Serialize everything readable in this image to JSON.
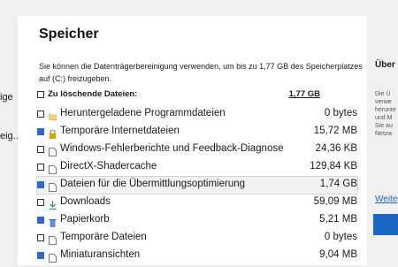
{
  "sidebar": {
    "items": [
      {
        "label": "ige"
      },
      {
        "label": "eig..."
      }
    ]
  },
  "main": {
    "title": "Speicher",
    "description": "Sie können die Datenträgerbereinigung verwenden, um bis zu 1,77 GB des Speicherplatzes auf  (C:) freizugeben.",
    "header": {
      "label": "Zu löschende Dateien:",
      "total": "1,77 GB",
      "checked": false
    },
    "files": [
      {
        "label": "Heruntergeladene Programmdateien",
        "size": "0 bytes",
        "checked": false,
        "icon": "folder-icon",
        "iconColor": "#f3d36b"
      },
      {
        "label": "Temporäre Internetdateien",
        "size": "15,72 MB",
        "checked": true,
        "icon": "lock-icon",
        "iconColor": "#d6a400"
      },
      {
        "label": "Windows-Fehlerberichte und Feedback-Diagnose",
        "size": "24,36 KB",
        "checked": false,
        "icon": "file-icon",
        "iconColor": "#ffffff"
      },
      {
        "label": "DirectX-Shadercache",
        "size": "129,84 KB",
        "checked": false,
        "icon": "file-icon",
        "iconColor": "#ffffff"
      },
      {
        "label": "Dateien für die Übermittlungsoptimierung",
        "size": "1,74 GB",
        "checked": true,
        "icon": "file-icon",
        "iconColor": "#ffffff",
        "selected": true
      },
      {
        "label": "Downloads",
        "size": "59,09 MB",
        "checked": false,
        "icon": "download-icon",
        "iconColor": "#1a9c5b"
      },
      {
        "label": "Papierkorb",
        "size": "5,21 MB",
        "checked": true,
        "icon": "recycle-bin-icon",
        "iconColor": "#5b8fd6"
      },
      {
        "label": "Temporäre Dateien",
        "size": "0 bytes",
        "checked": false,
        "icon": "file-icon",
        "iconColor": "#ffffff"
      },
      {
        "label": "Miniaturansichten",
        "size": "9,04 MB",
        "checked": true,
        "icon": "file-icon",
        "iconColor": "#ffffff"
      }
    ]
  },
  "rightPanel": {
    "title": "Über",
    "description": "Die Ü verwe herunte und M Sie au Netzw",
    "link": "Weite"
  },
  "colors": {
    "accent": "#2f68c8",
    "link": "#1a66c2"
  }
}
